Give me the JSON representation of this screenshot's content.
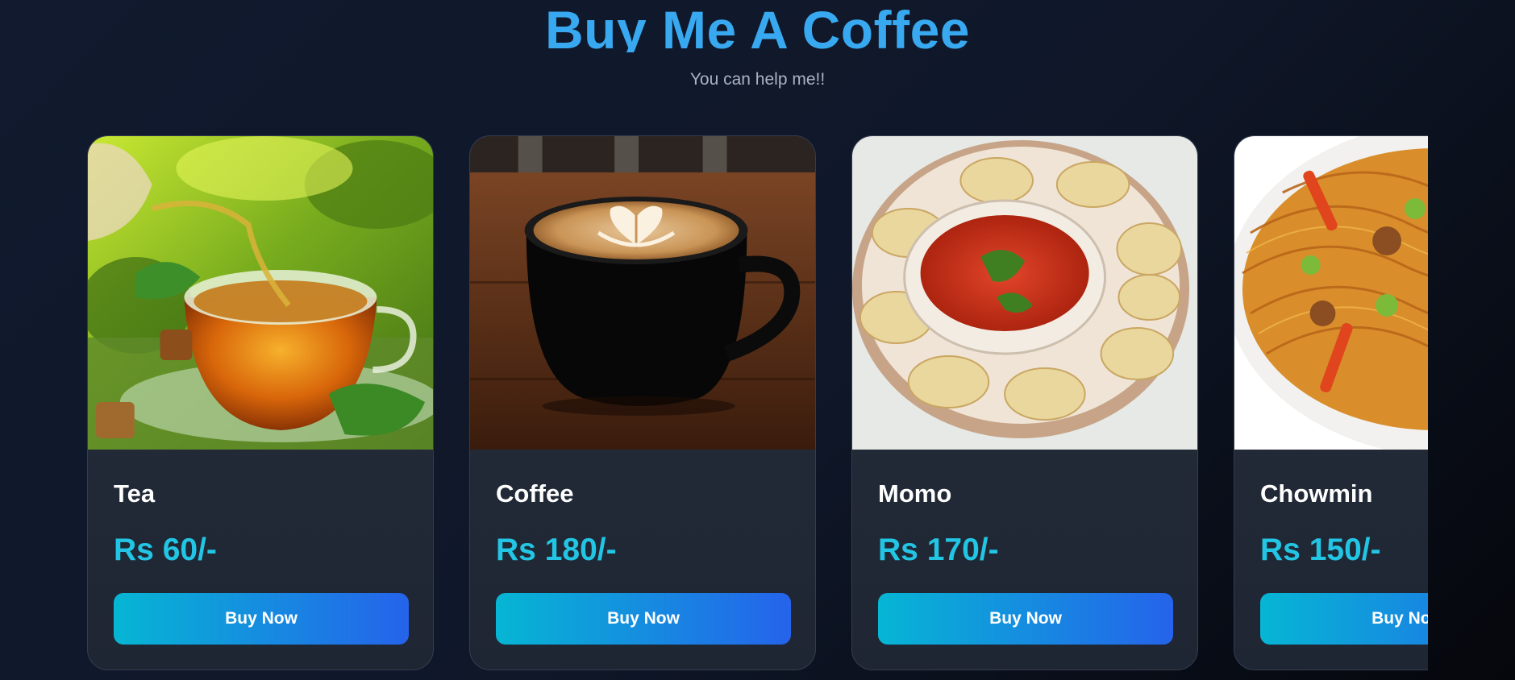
{
  "header": {
    "title": "Buy Me A Coffee",
    "subtitle": "You can help me!!"
  },
  "products": [
    {
      "name": "Tea",
      "price": "Rs 60/-",
      "button_label": "Buy Now"
    },
    {
      "name": "Coffee",
      "price": "Rs 180/-",
      "button_label": "Buy Now"
    },
    {
      "name": "Momo",
      "price": "Rs 170/-",
      "button_label": "Buy Now"
    },
    {
      "name": "Chowmin",
      "price": "Rs 150/-",
      "button_label": "Buy Now"
    }
  ],
  "colors": {
    "title": "#38a9f0",
    "price": "#22c6e4",
    "button_gradient_start": "#06b6d4",
    "button_gradient_end": "#2563eb",
    "card_background": "#252d3d",
    "page_background": "#0f1729"
  }
}
